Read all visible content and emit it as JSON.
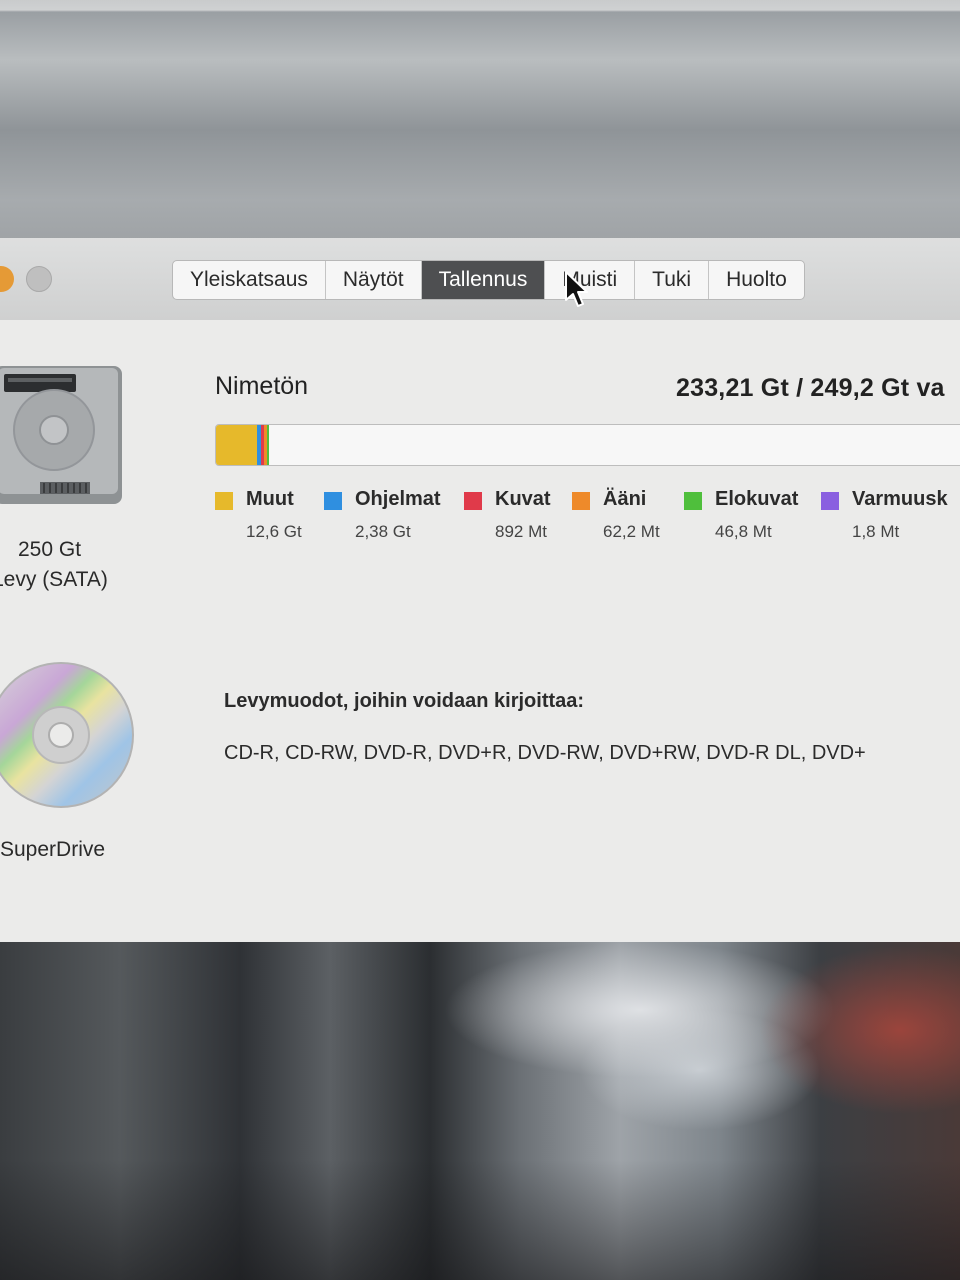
{
  "window": {
    "tabs": [
      {
        "label": "Yleiskatsaus",
        "active": false
      },
      {
        "label": "Näytöt",
        "active": false
      },
      {
        "label": "Tallennus",
        "active": true
      },
      {
        "label": "Muisti",
        "active": false
      },
      {
        "label": "Tuki",
        "active": false
      },
      {
        "label": "Huolto",
        "active": false
      }
    ]
  },
  "devices": {
    "disk": {
      "icon": "hard-drive-icon",
      "size_label": "250 Gt",
      "type_label": "Levy (SATA)"
    },
    "optical": {
      "icon": "optical-disc-icon",
      "name": "SuperDrive"
    }
  },
  "storage": {
    "volume_name": "Nimetön",
    "capacity_text": "233,21 Gt / 249,2 Gt va",
    "used_fraction": 0.07,
    "categories": [
      {
        "name": "Muut",
        "size": "12,6 Gt",
        "color": "#e6b92b"
      },
      {
        "name": "Ohjelmat",
        "size": "2,38 Gt",
        "color": "#2f8fe0"
      },
      {
        "name": "Kuvat",
        "size": "892 Mt",
        "color": "#e03a4a"
      },
      {
        "name": "Ääni",
        "size": "62,2 Mt",
        "color": "#ee8a2a"
      },
      {
        "name": "Elokuvat",
        "size": "46,8 Mt",
        "color": "#4fbf3c"
      },
      {
        "name": "Varmuusk",
        "size": "1,8 Mt",
        "color": "#8a5fe0"
      }
    ]
  },
  "optical_drive": {
    "formats_title": "Levymuodot, joihin voidaan kirjoittaa:",
    "formats": "CD-R, CD-RW, DVD-R, DVD+R, DVD-RW, DVD+RW, DVD-R DL, DVD+"
  }
}
